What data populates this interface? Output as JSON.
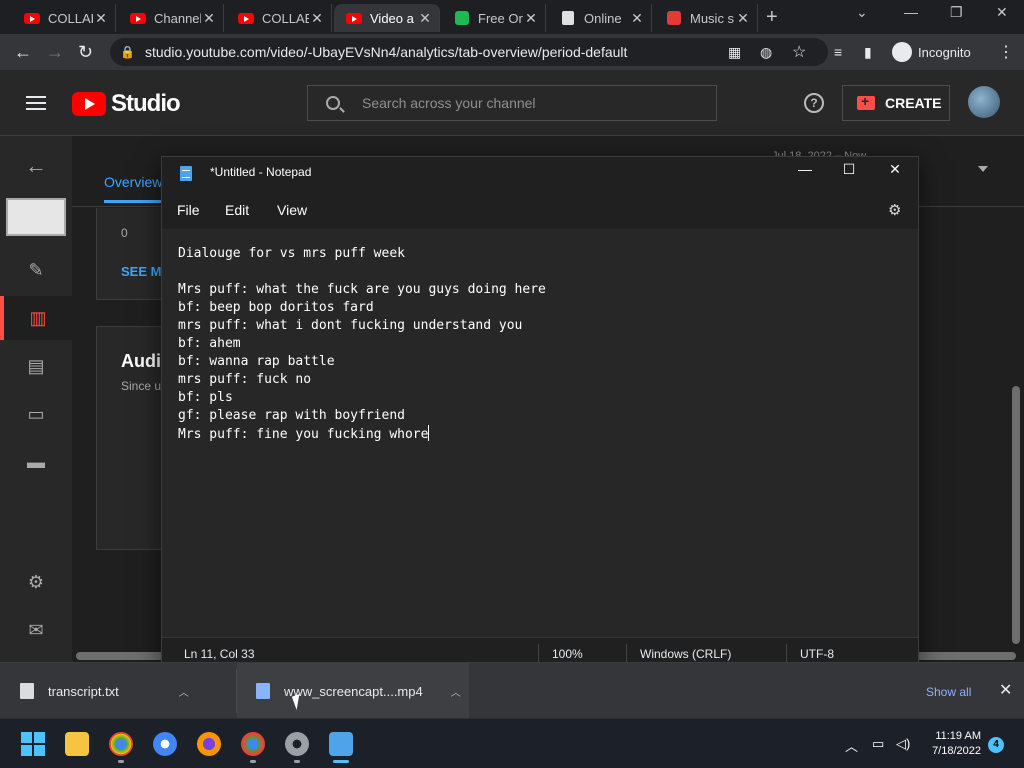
{
  "browser": {
    "tabs": [
      {
        "title": "COLLAB",
        "icon": "youtube-icon"
      },
      {
        "title": "Channel",
        "icon": "youtube-icon"
      },
      {
        "title": "COLLAB",
        "icon": "youtube-icon"
      },
      {
        "title": "Video a",
        "icon": "youtube-icon"
      },
      {
        "title": "Free On",
        "icon": "green-app-icon"
      },
      {
        "title": "Online",
        "icon": "notepad-icon"
      },
      {
        "title": "Music s",
        "icon": "red-bolt-icon"
      }
    ],
    "url": "studio.youtube.com/video/-UbayEVsNn4/analytics/tab-overview/period-default",
    "incognito_label": "Incognito"
  },
  "studio": {
    "logo_text": "Studio",
    "search_placeholder": "Search across your channel",
    "create_label": "CREATE",
    "overview_tab": "Overview",
    "date_hint": "Jul 18, 2022 – Now",
    "card1_axis_zero": "0",
    "card1_link": "SEE M",
    "card2_title": "Audi",
    "card2_subtitle": "Since u"
  },
  "notepad": {
    "title": "*Untitled - Notepad",
    "menu": [
      "File",
      "Edit",
      "View"
    ],
    "content": "Dialouge for vs mrs puff week\n\nMrs puff: what the fuck are you guys doing here\nbf: beep bop doritos fard\nmrs puff: what i dont fucking understand you\nbf: ahem\nbf: wanna rap battle\nmrs puff: fuck no\nbf: pls\ngf: please rap with boyfriend\nMrs puff: fine you fucking whore",
    "status": {
      "position": "Ln 11, Col 33",
      "zoom": "100%",
      "line_endings": "Windows (CRLF)",
      "encoding": "UTF-8"
    }
  },
  "downloads": {
    "items": [
      {
        "name": "transcript.txt"
      },
      {
        "name": "www_screencapt....mp4"
      }
    ],
    "show_all": "Show all"
  },
  "taskbar": {
    "time": "11:19 AM",
    "date": "7/18/2022",
    "notification_count": "4"
  },
  "colors": {
    "accent_blue": "#3ea6ff",
    "yt_red": "#ff0000",
    "windows_blue": "#4cc2ff"
  }
}
